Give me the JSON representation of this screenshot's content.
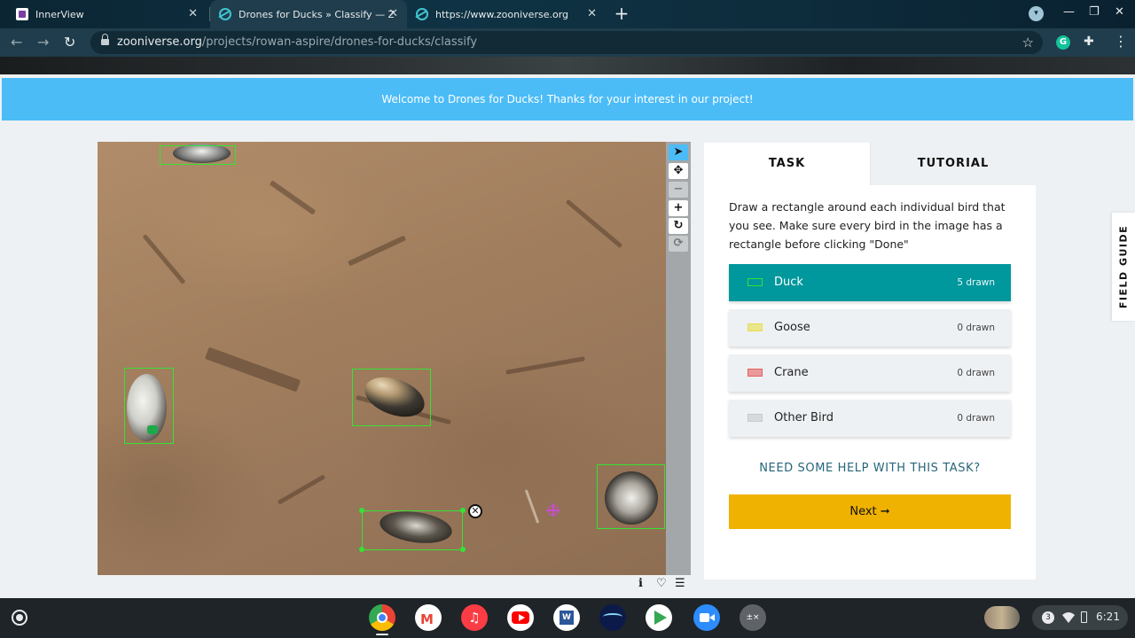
{
  "browser": {
    "tabs": [
      {
        "title": "InnerView",
        "active": false
      },
      {
        "title": "Drones for Ducks » Classify — Zooniverse",
        "active": true
      },
      {
        "title": "https://www.zooniverse.org/projects",
        "active": false
      }
    ],
    "url_host": "zooniverse.org",
    "url_path": "/projects/rowan-aspire/drones-for-ducks/classify"
  },
  "banner": {
    "text": "Welcome to Drones for Ducks! Thanks for your interest in our project!"
  },
  "task_panel": {
    "tabs": [
      "TASK",
      "TUTORIAL"
    ],
    "instructions": "Draw a rectangle around each individual bird that you see. Make sure every bird in the image has a rectangle before clicking \"Done\"",
    "choices": [
      {
        "label": "Duck",
        "count": "5 drawn",
        "color": "#35e235",
        "selected": true
      },
      {
        "label": "Goose",
        "count": "0 drawn",
        "color": "#e6e04a",
        "selected": false
      },
      {
        "label": "Crane",
        "count": "0 drawn",
        "color": "#e66060",
        "selected": false
      },
      {
        "label": "Other Bird",
        "count": "0 drawn",
        "color": "#c8cbcd",
        "selected": false
      }
    ],
    "help_link": "NEED SOME HELP WITH THIS TASK?",
    "next_label": "Next ➞"
  },
  "field_guide": "FIELD GUIDE",
  "system": {
    "time": "6:21",
    "notifications": "3"
  },
  "colors": {
    "accent": "#4cbcf7",
    "selected_choice": "#00979d",
    "next_button": "#f0b200",
    "drawn_box": "#35e235"
  }
}
